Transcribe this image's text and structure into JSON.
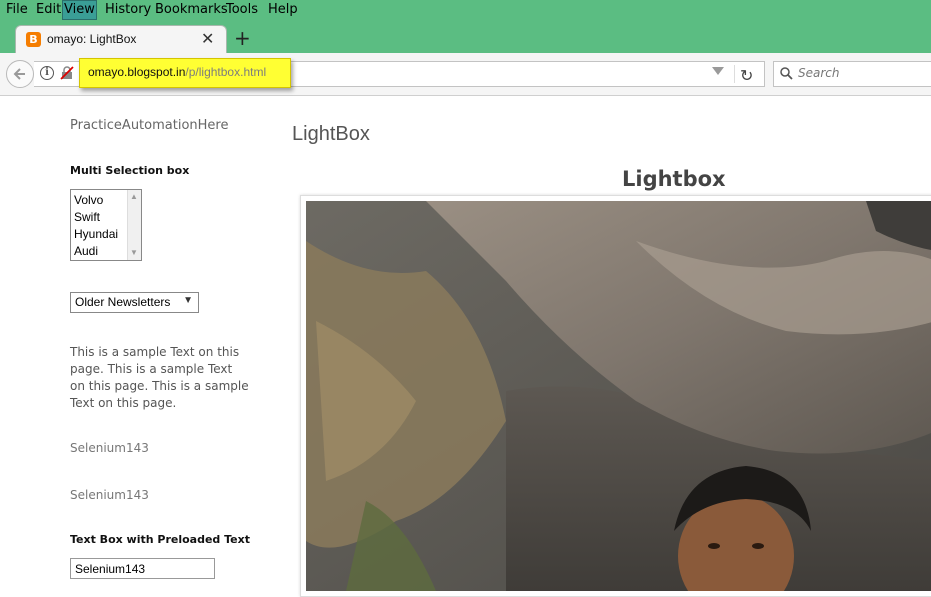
{
  "menubar": {
    "items": [
      {
        "label": "File"
      },
      {
        "label": "Edit"
      },
      {
        "label": "View"
      },
      {
        "label": "History"
      },
      {
        "label": "Bookmarks"
      },
      {
        "label": "Tools"
      },
      {
        "label": "Help"
      }
    ]
  },
  "tab": {
    "title": "omayo: LightBox",
    "favicon_letter": "B",
    "close_glyph": "✕",
    "new_tab_glyph": "+"
  },
  "navbar": {
    "info_glyph": "i",
    "url_host": "omayo.blogspot.in",
    "url_path": "/p/lightbox.html",
    "reload_glyph": "↻",
    "search_placeholder": "Search"
  },
  "sidebar": {
    "site_title": "PracticeAutomationHere",
    "multi_selection_heading": "Multi Selection box",
    "multi_selection_options": [
      "Volvo",
      "Swift",
      "Hyundai",
      "Audi"
    ],
    "newsletter_selected": "Older Newsletters",
    "sample_text": "This is a sample Text on this page. This is a sample Text on this page. This is a sample Text on this page.",
    "selenium_text_1": "Selenium143",
    "selenium_text_2": "Selenium143",
    "preloaded_heading": "Text Box with Preloaded Text",
    "preloaded_value": "Selenium143"
  },
  "main": {
    "post_title": "LightBox",
    "lightbox_heading": "Lightbox"
  },
  "colors": {
    "menubar_bg": "#5bbd82",
    "url_highlight": "#ffff33",
    "favicon": "#f57d00"
  }
}
